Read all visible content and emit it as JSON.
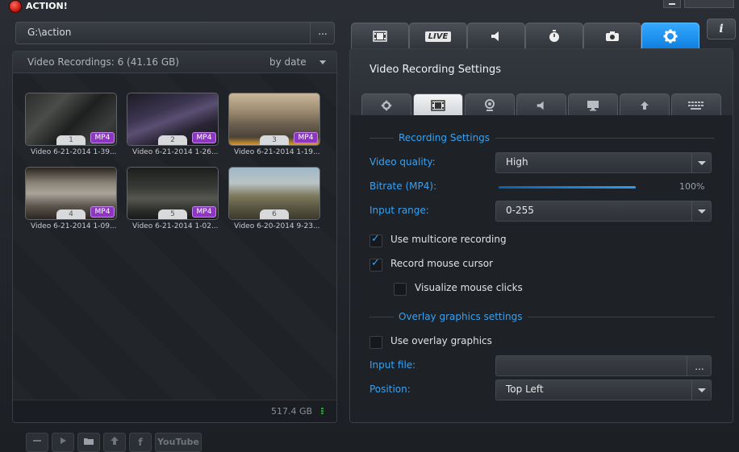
{
  "app": {
    "title": "ACTION!"
  },
  "path": {
    "value": "G:\\action",
    "browse_label": "..."
  },
  "recordings": {
    "header": "Video Recordings: 6 (41.16 GB)",
    "sort": "by date",
    "items": [
      {
        "num": "1",
        "format": "MP4",
        "title": "Video 6-21-2014 1-39..."
      },
      {
        "num": "2",
        "format": "MP4",
        "title": "Video 6-21-2014 1-26..."
      },
      {
        "num": "3",
        "format": "MP4",
        "title": "Video 6-21-2014 1-19..."
      },
      {
        "num": "4",
        "format": "MP4",
        "title": "Video 6-21-2014 1-09..."
      },
      {
        "num": "5",
        "format": "MP4",
        "title": "Video 6-21-2014 1-02..."
      },
      {
        "num": "6",
        "format": "",
        "title": "Video 6-20-2014 9-23..."
      }
    ],
    "disk_free": "517.4 GB"
  },
  "bottom_toolbar": {
    "youtube_label": "YouTube",
    "facebook_label": "f"
  },
  "main_tabs": {
    "live_label": "LIVE"
  },
  "info_label": "i",
  "settings": {
    "title": "Video Recording Settings",
    "recording_section": "Recording Settings",
    "video_quality_label": "Video quality:",
    "video_quality_value": "High",
    "bitrate_label": "Bitrate (MP4):",
    "bitrate_value": "100%",
    "bitrate_fraction": 1.0,
    "input_range_label": "Input range:",
    "input_range_value": "0-255",
    "multicore_label": "Use multicore recording",
    "multicore_checked": true,
    "mouse_cursor_label": "Record mouse cursor",
    "mouse_cursor_checked": true,
    "mouse_clicks_label": "Visualize mouse clicks",
    "mouse_clicks_checked": false,
    "overlay_section": "Overlay graphics settings",
    "overlay_label": "Use overlay graphics",
    "overlay_checked": false,
    "input_file_label": "Input file:",
    "input_file_value": "",
    "input_file_browse": "...",
    "position_label": "Position:",
    "position_value": "Top Left"
  },
  "colors": {
    "accent": "#3aa2f0",
    "active_tab": "#1a8ff0",
    "badge": "#8e35c4"
  }
}
